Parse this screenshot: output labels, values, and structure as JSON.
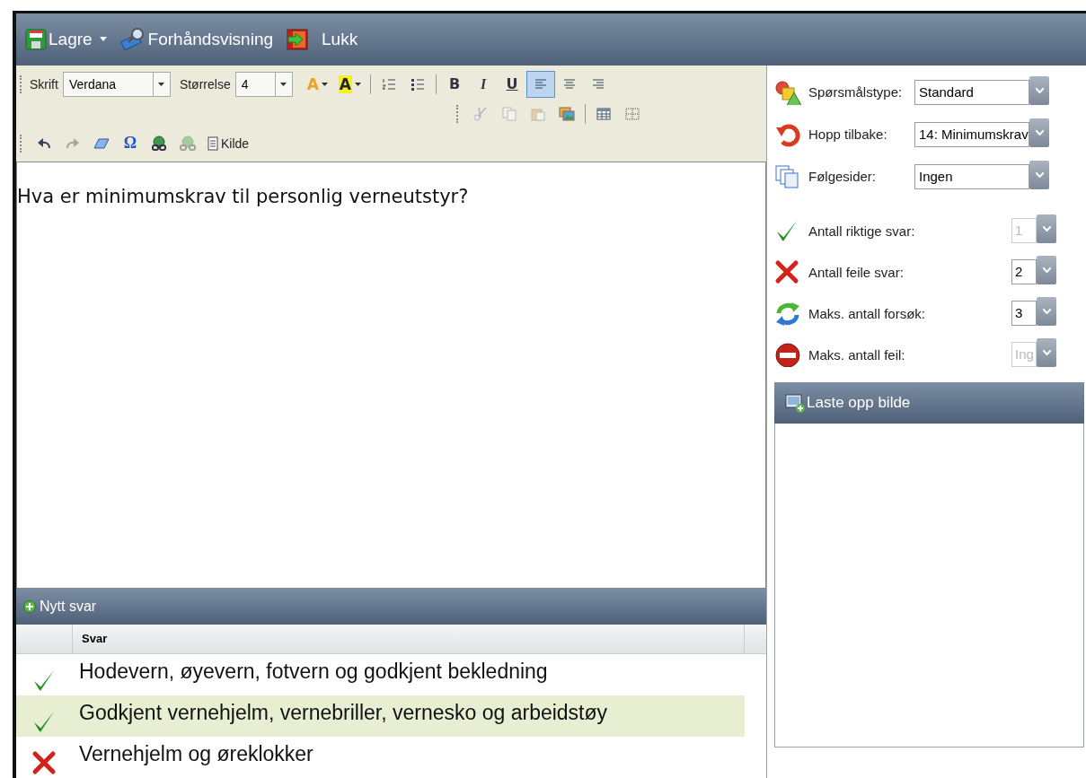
{
  "top_toolbar": [
    {
      "kind": "save",
      "label": "Lagre",
      "dropdown": true
    },
    {
      "kind": "preview",
      "label": "Forhåndsvisning",
      "dropdown": false
    },
    {
      "kind": "exit",
      "label": "Lukk",
      "dropdown": false
    }
  ],
  "editor_toolbar": {
    "font": {
      "label": "Skrift",
      "value": "Verdana"
    },
    "size": {
      "label": "Størrelse",
      "value": "4"
    },
    "row_1": [
      {
        "kind": "fontcolor",
        "glyph": "A",
        "disabled": false,
        "selected": false
      },
      {
        "kind": "highlight",
        "glyph": "A",
        "disabled": false,
        "selected": false
      },
      {
        "kind": "sep"
      },
      {
        "kind": "olist",
        "disabled": false,
        "selected": false
      },
      {
        "kind": "ulist",
        "disabled": false,
        "selected": false
      },
      {
        "kind": "sep"
      },
      {
        "kind": "bold",
        "glyph": "B",
        "disabled": false,
        "selected": false
      },
      {
        "kind": "italic",
        "glyph": "I",
        "disabled": false,
        "selected": false
      },
      {
        "kind": "underline",
        "glyph": "U",
        "disabled": false,
        "selected": false
      },
      {
        "kind": "alignleft",
        "disabled": false,
        "selected": true
      },
      {
        "kind": "aligncenter",
        "disabled": false,
        "selected": false
      },
      {
        "kind": "alignright",
        "disabled": false,
        "selected": false
      }
    ],
    "row_2": [
      {
        "kind": "cut",
        "disabled": true,
        "selected": false
      },
      {
        "kind": "copy",
        "disabled": true,
        "selected": false
      },
      {
        "kind": "paste",
        "disabled": true,
        "selected": false
      },
      {
        "kind": "image",
        "disabled": false,
        "selected": false
      },
      {
        "kind": "sep"
      },
      {
        "kind": "table",
        "disabled": false,
        "selected": false
      },
      {
        "kind": "grid",
        "disabled": false,
        "selected": false
      }
    ],
    "row_3": [
      {
        "kind": "undo",
        "disabled": false,
        "selected": false
      },
      {
        "kind": "redo",
        "disabled": true,
        "selected": false
      },
      {
        "kind": "eraser",
        "disabled": false,
        "selected": false
      },
      {
        "kind": "symbol",
        "glyph": "Ω",
        "disabled": false,
        "selected": false
      },
      {
        "kind": "link",
        "disabled": false,
        "selected": false
      },
      {
        "kind": "unlink",
        "disabled": true,
        "selected": false
      },
      {
        "kind": "source",
        "label": "Kilde",
        "disabled": false,
        "selected": false
      }
    ]
  },
  "editor": {
    "text": "Hva er minimumskrav til personlig verneutstyr?"
  },
  "answers": {
    "add_button": "Nytt svar",
    "column": "Svar",
    "rows": [
      {
        "text": "Hodevern, øyevern, fotvern og godkjent bekledning",
        "correct": true,
        "selected": false
      },
      {
        "text": "Godkjent vernehjelm, vernebriller, vernesko og arbeidstøy",
        "correct": true,
        "selected": true
      },
      {
        "text": "Vernehjelm og øreklokker",
        "correct": false,
        "selected": false
      }
    ]
  },
  "question_settings": [
    {
      "kind": "shapes",
      "label": "Spørsmålstype:",
      "value": "Standard",
      "disabled": false
    },
    {
      "kind": "back",
      "label": "Hopp tilbake:",
      "value": "14: Minimumskrav",
      "disabled": false
    },
    {
      "kind": "pages",
      "label": "Følgesider:",
      "value": "Ingen",
      "disabled": false
    }
  ],
  "answer_limits": [
    {
      "kind": "check",
      "label": "Antall riktige svar:",
      "value": "1",
      "disabled": true
    },
    {
      "kind": "cross",
      "label": "Antall feile svar:",
      "value": "2",
      "disabled": false
    },
    {
      "kind": "refresh",
      "label": "Maks. antall forsøk:",
      "value": "3",
      "disabled": false
    },
    {
      "kind": "stop",
      "label": "Maks. antall feil:",
      "value": "Ing",
      "disabled": true
    }
  ],
  "upload_panel": {
    "title": "Laste opp bilde"
  }
}
